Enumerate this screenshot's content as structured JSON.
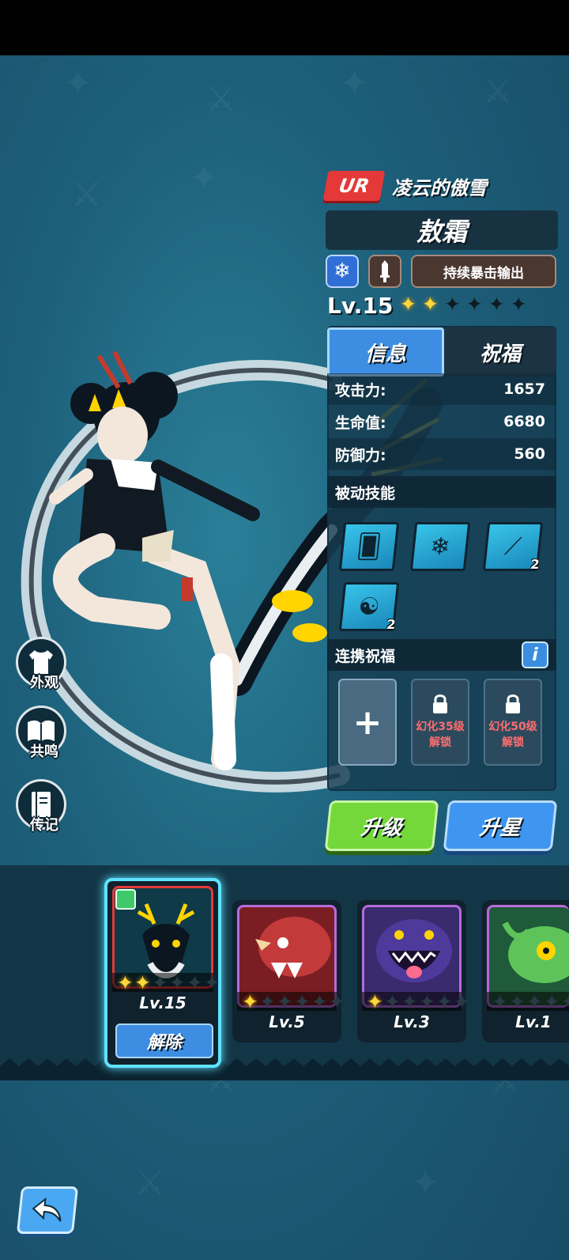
{
  "hero": {
    "rarity": "UR",
    "title": "凌云的傲雪",
    "name": "敖霜",
    "element_icon": "snowflake-icon",
    "weapon_icon": "sword-icon",
    "role": "持续暴击输出",
    "level": "Lv.15",
    "stars_total": 6,
    "stars_filled": 2
  },
  "tabs": {
    "info": "信息",
    "blessing": "祝福"
  },
  "stats": [
    {
      "label": "攻击力:",
      "value": "1657"
    },
    {
      "label": "生命值:",
      "value": "6680"
    },
    {
      "label": "防御力:",
      "value": "560"
    }
  ],
  "passive": {
    "header": "被动技能",
    "skills": [
      {
        "icon": "card-snowflake-icon",
        "count": ""
      },
      {
        "icon": "snowflakes-icon",
        "count": ""
      },
      {
        "icon": "claw-slash-icon",
        "count": "2"
      },
      {
        "icon": "dragon-head-icon",
        "count": "2"
      }
    ]
  },
  "link_blessing": {
    "header": "连携祝福",
    "info_label": "i",
    "slots": [
      {
        "type": "add",
        "label": "+"
      },
      {
        "type": "locked",
        "line1": "幻化35级",
        "line2": "解锁"
      },
      {
        "type": "locked",
        "line1": "幻化50级",
        "line2": "解锁"
      }
    ]
  },
  "actions": {
    "upgrade": "升级",
    "star_up": "升星"
  },
  "side_menu": [
    {
      "label": "外观",
      "icon": "shirt-icon"
    },
    {
      "label": "共鸣",
      "icon": "book-icon"
    },
    {
      "label": "传记",
      "icon": "journal-icon"
    }
  ],
  "pets": [
    {
      "level": "Lv.15",
      "stars_filled": 2,
      "stars_total": 6,
      "frame": "#e53939",
      "selected": true,
      "remove_label": "解除"
    },
    {
      "level": "Lv.5",
      "stars_filled": 1,
      "stars_total": 6,
      "frame": "#b76bdc",
      "selected": false
    },
    {
      "level": "Lv.3",
      "stars_filled": 1,
      "stars_total": 6,
      "frame": "#b76bdc",
      "selected": false
    },
    {
      "level": "Lv.1",
      "stars_filled": 0,
      "stars_total": 6,
      "frame": "#b76bdc",
      "selected": false
    }
  ],
  "back_icon": "back-arrow-icon",
  "colors": {
    "rarity_red": "#e53939",
    "tab_blue": "#3d8ee3",
    "upgrade_green": "#74d83a",
    "star_gold": "#ffd83a"
  }
}
